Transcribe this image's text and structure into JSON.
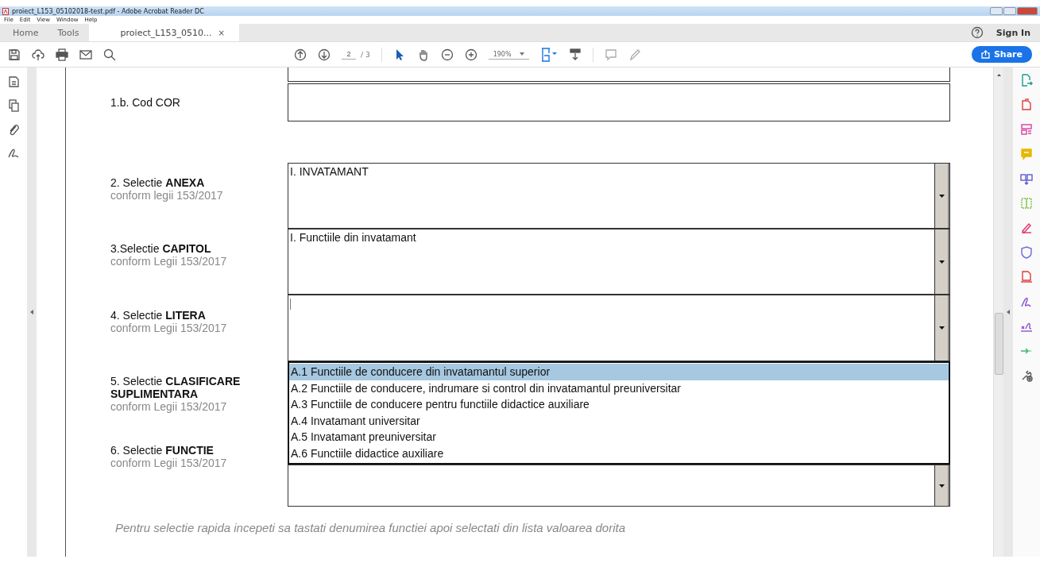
{
  "window": {
    "title": "proiect_L153_05102018-test.pdf - Adobe Acrobat Reader DC"
  },
  "menu": [
    "File",
    "Edit",
    "View",
    "Window",
    "Help"
  ],
  "tabs": [
    {
      "label": "Home",
      "kind": "nav",
      "selected": false
    },
    {
      "label": "Tools",
      "kind": "nav",
      "selected": false
    },
    {
      "label": "proiect_L153_0510...",
      "kind": "doc",
      "selected": true,
      "close": "×"
    }
  ],
  "account": {
    "sign_in": "Sign In"
  },
  "toolbar": {
    "page": "2",
    "page_total": "/ 3",
    "zoom": "190%",
    "share": "Share"
  },
  "form": {
    "rows": [
      {
        "kind": "cut",
        "dropdown": false
      },
      {
        "label": "1.b. Cod COR",
        "kind": "field",
        "value": null,
        "dropdown": false
      },
      {
        "label": "2. Selectie **ANEXA**",
        "sublabel": "conform legii 153/2017",
        "kind": "field",
        "value": "I. INVATAMANT",
        "dropdown": true
      },
      {
        "label": "3.Selectie **CAPITOL**",
        "sublabel": "conform Legii 153/2017",
        "kind": "field",
        "value": "I. Functiile din invatamant",
        "dropdown": true
      },
      {
        "label": "4. Selectie **LITERA**",
        "sublabel": "conform Legii 153/2017",
        "kind": "field",
        "value": null,
        "cursor": true,
        "dropdown": true
      },
      {
        "label": "5. Selectie **CLASIFICARE SUPLIMENTARA**",
        "sublabel": "conform Legii 153/2017",
        "kind": "list",
        "options": [
          {
            "text": "A.1 Functiile de conducere din invatamantul superior",
            "selected": true
          },
          {
            "text": "A.2 Functiile de conducere, indrumare si control din invatamantul preuniversitar",
            "selected": false
          },
          {
            "text": "A.3 Functiile de conducere pentru functiile didactice auxiliare",
            "selected": false
          },
          {
            "text": "A.4 Invatamant universitar",
            "selected": false
          },
          {
            "text": "A.5 Invatamant preuniversitar",
            "selected": false
          },
          {
            "text": "A.6 Functiile didactice auxiliare",
            "selected": false
          }
        ]
      },
      {
        "label": "6.  Selectie **FUNCTIE**",
        "sublabel": "conform Legii 153/2017",
        "kind": "field",
        "value": null,
        "dropdown": true
      }
    ],
    "hint": "Pentru selectie rapida incepeti sa tastati denumirea functiei apoi selectati din lista valoarea dorita"
  }
}
